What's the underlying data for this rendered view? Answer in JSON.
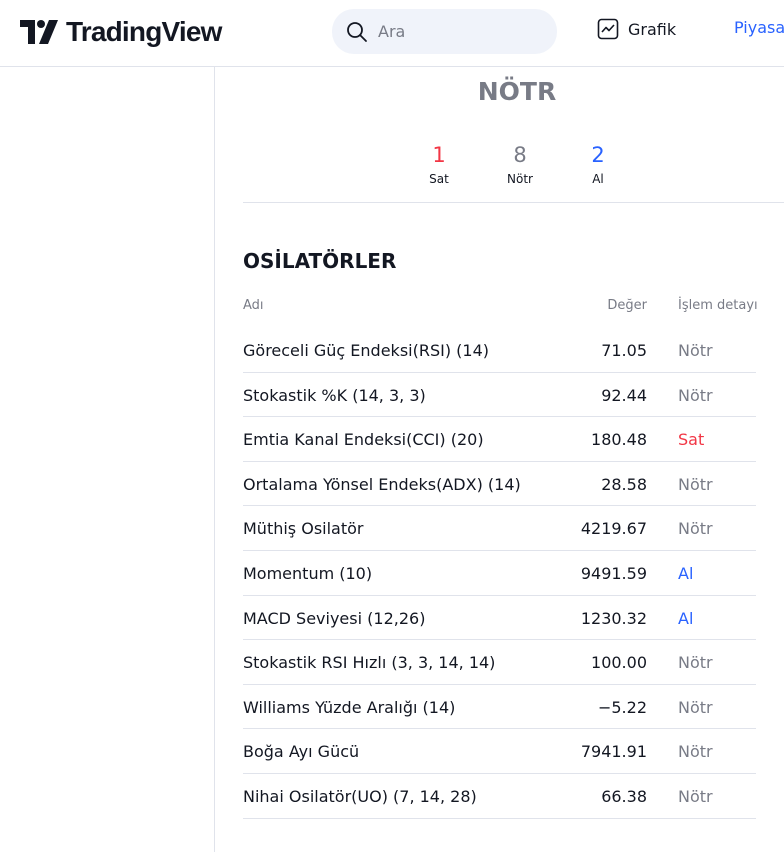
{
  "header": {
    "logo_text": "TradingView",
    "search_placeholder": "Ara",
    "nav": [
      {
        "label": "Grafik",
        "icon": "chart-icon"
      },
      {
        "label": "Piyasa"
      }
    ]
  },
  "summary": {
    "verdict": "NÖTR",
    "counts": [
      {
        "value": "1",
        "label": "Sat",
        "color": "#f23645"
      },
      {
        "value": "8",
        "label": "Nötr",
        "color": "#787b86"
      },
      {
        "value": "2",
        "label": "Al",
        "color": "#2962ff"
      }
    ]
  },
  "oscillators": {
    "title": "OSİLATÖRLER",
    "columns": [
      "Adı",
      "Değer",
      "İşlem detayı"
    ],
    "rows": [
      {
        "name": "Göreceli Güç Endeksi(RSI) (14)",
        "value": "71.05",
        "action": "Nötr"
      },
      {
        "name": "Stokastik %K (14, 3, 3)",
        "value": "92.44",
        "action": "Nötr"
      },
      {
        "name": "Emtia Kanal Endeksi(CCI) (20)",
        "value": "180.48",
        "action": "Sat"
      },
      {
        "name": "Ortalama Yönsel Endeks(ADX) (14)",
        "value": "28.58",
        "action": "Nötr"
      },
      {
        "name": "Müthiş Osilatör",
        "value": "4219.67",
        "action": "Nötr"
      },
      {
        "name": "Momentum (10)",
        "value": "9491.59",
        "action": "Al"
      },
      {
        "name": "MACD Seviyesi (12,26)",
        "value": "1230.32",
        "action": "Al"
      },
      {
        "name": "Stokastik RSI Hızlı (3, 3, 14, 14)",
        "value": "100.00",
        "action": "Nötr"
      },
      {
        "name": "Williams Yüzde Aralığı (14)",
        "value": "−5.22",
        "action": "Nötr"
      },
      {
        "name": "Boğa Ayı Gücü",
        "value": "7941.91",
        "action": "Nötr"
      },
      {
        "name": "Nihai Osilatör(UO) (7, 14, 28)",
        "value": "66.38",
        "action": "Nötr"
      }
    ]
  }
}
